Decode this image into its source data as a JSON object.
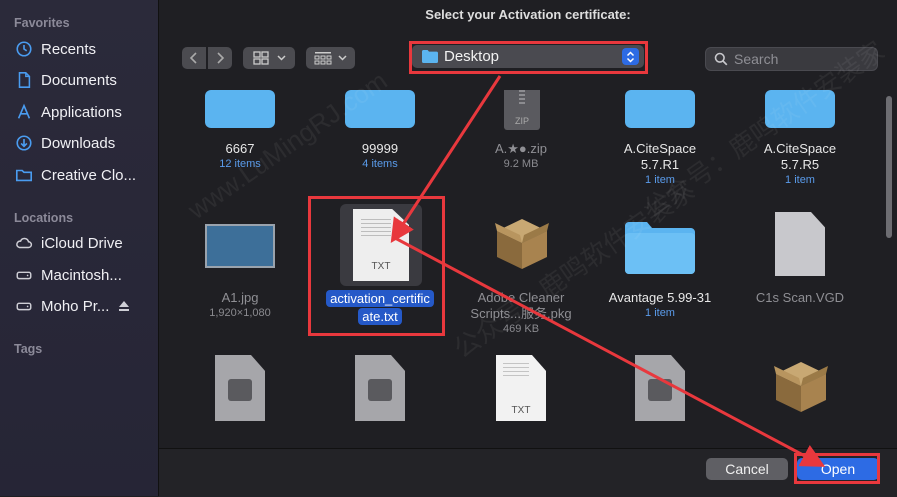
{
  "title": "Select your Activation certificate:",
  "sidebar": {
    "favorites_heading": "Favorites",
    "favorites": [
      {
        "label": "Recents",
        "icon": "clock-icon"
      },
      {
        "label": "Documents",
        "icon": "document-icon"
      },
      {
        "label": "Applications",
        "icon": "applications-icon"
      },
      {
        "label": "Downloads",
        "icon": "download-icon"
      },
      {
        "label": "Creative Clo...",
        "icon": "folder-icon"
      }
    ],
    "locations_heading": "Locations",
    "locations": [
      {
        "label": "iCloud Drive",
        "icon": "cloud-icon"
      },
      {
        "label": "Macintosh...",
        "icon": "disk-icon"
      },
      {
        "label": "Moho Pr...",
        "icon": "disk-icon"
      }
    ],
    "tags_heading": "Tags"
  },
  "toolbar": {
    "location": "Desktop",
    "search_placeholder": "Search"
  },
  "files": [
    {
      "name": "6667",
      "sub": "12 items",
      "kind": "folder"
    },
    {
      "name": "99999",
      "sub": "4 items",
      "kind": "folder"
    },
    {
      "name": "A.★●.zip",
      "sub": "9.2 MB",
      "kind": "zip"
    },
    {
      "name": "A.CiteSpace 5.7.R1",
      "sub": "1 item",
      "kind": "folder"
    },
    {
      "name": "A.CiteSpace 5.7.R5",
      "sub": "1 item",
      "kind": "folder"
    },
    {
      "name": "A1.jpg",
      "sub": "1,920×1,080",
      "kind": "image"
    },
    {
      "name": "activation_certificate.txt",
      "sub": "",
      "kind": "txt"
    },
    {
      "name": "Adobe Cleaner Scripts...服务.pkg",
      "sub": "469 KB",
      "kind": "pkg"
    },
    {
      "name": "Avantage 5.99-31",
      "sub": "1 item",
      "kind": "folder"
    },
    {
      "name": "C1s Scan.VGD",
      "sub": "",
      "kind": "doc"
    }
  ],
  "file_display": {
    "zip_badge": "ZIP",
    "txt_badge": "TXT",
    "cert_line1": "activation_certific",
    "cert_line2": "ate.txt",
    "adobe_line1": "Adobe Cleaner",
    "adobe_line2": "Scripts...服务.pkg",
    "cite1_line1": "A.CiteSpace",
    "cite1_line2": "5.7.R1",
    "cite5_line1": "A.CiteSpace",
    "cite5_line2": "5.7.R5"
  },
  "watermark": [
    "www.LuMingRJ.com",
    "公众号：鹿鸣软件安装家"
  ],
  "footer": {
    "cancel_label": "Cancel",
    "open_label": "Open"
  },
  "colors": {
    "accent": "#2d6be4",
    "highlight_box": "#e8383d",
    "folder": "#5bb4f0"
  }
}
